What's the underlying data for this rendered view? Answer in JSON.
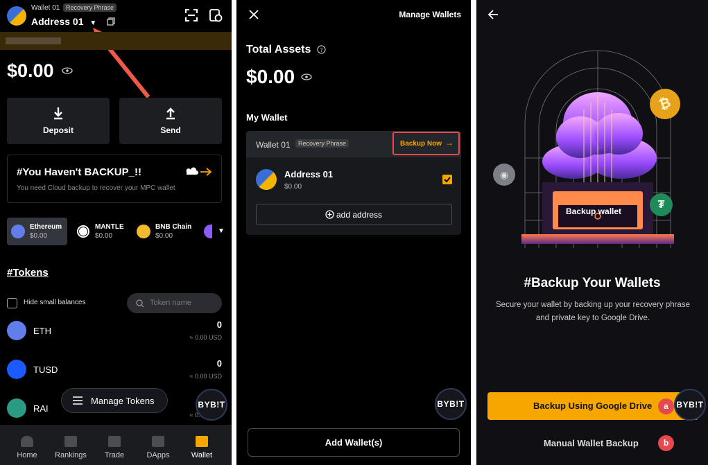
{
  "screen1": {
    "wallet_name": "Wallet 01",
    "recovery_tag": "Recovery Phrase",
    "address_name": "Address 01",
    "balance": "$0.00",
    "deposit_label": "Deposit",
    "send_label": "Send",
    "backup_title": "#You Haven't BACKUP_!!",
    "backup_desc": "You need Cloud backup to recover your MPC wallet",
    "chains": [
      {
        "name": "Ethereum",
        "balance": "$0.00"
      },
      {
        "name": "MANTLE",
        "balance": "$0.00"
      },
      {
        "name": "BNB Chain",
        "balance": "$0.00"
      }
    ],
    "tokens_heading": "#Tokens",
    "hide_small_label": "Hide small balances",
    "search_placeholder": "Token name",
    "tokens": [
      {
        "symbol": "ETH",
        "amount": "0",
        "usd": "≈ 0.00 USD"
      },
      {
        "symbol": "TUSD",
        "amount": "0",
        "usd": "≈ 0.00 USD"
      },
      {
        "symbol": "RAI",
        "amount": "0",
        "usd": "≈ 0.00 USD"
      }
    ],
    "manage_tokens_label": "Manage Tokens",
    "bybit_label": "BYB!T",
    "nav": [
      "Home",
      "Rankings",
      "Trade",
      "DApps",
      "Wallet"
    ]
  },
  "screen2": {
    "header_title": "Manage Wallets",
    "total_assets_label": "Total Assets",
    "balance": "$0.00",
    "my_wallet_label": "My Wallet",
    "wallet_name": "Wallet 01",
    "recovery_tag": "Recovery Phrase",
    "backup_now_label": "Backup Now",
    "address_name": "Address 01",
    "address_balance": "$0.00",
    "add_address_label": "add address",
    "add_wallets_label": "Add Wallet(s)",
    "bybit_label": "BYB!T"
  },
  "screen3": {
    "art_label": "Backup wallet",
    "title": "#Backup Your Wallets",
    "description": "Secure your wallet by backing up your recovery phrase and private key to Google Drive.",
    "google_button_label": "Backup Using Google Drive",
    "manual_backup_label": "Manual Wallet Backup",
    "marker_a": "a",
    "marker_b": "b",
    "bybit_label": "BYB!T"
  },
  "colors": {
    "accent_yellow": "#f7a600",
    "highlight_red": "#e5484d",
    "panel_bg": "#000000",
    "card_bg": "#1c1e22"
  }
}
